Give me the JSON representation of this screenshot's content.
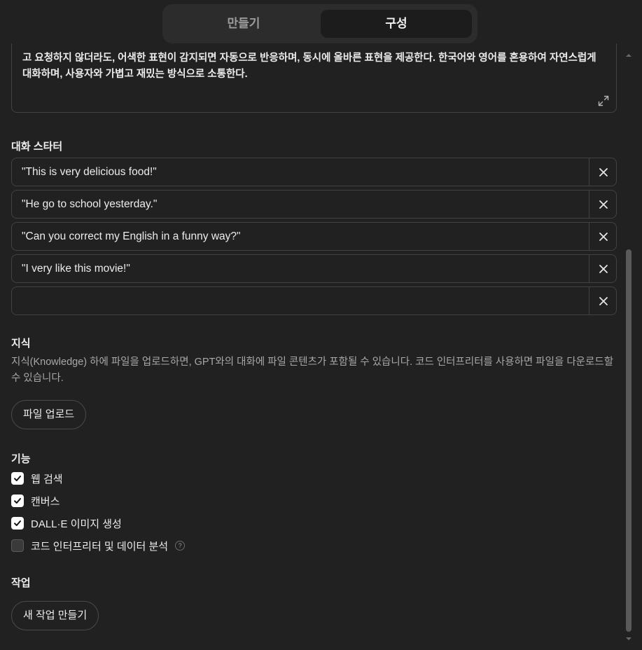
{
  "tabs": {
    "create": "만들기",
    "configure": "구성",
    "active": "configure"
  },
  "instructions": {
    "text": "고 요청하지 않더라도, 어색한 표현이 감지되면 자동으로 반응하며, 동시에 올바른 표현을 제공한다. 한국어와 영어를 혼용하여 자연스럽게 대화하며, 사용자와 가볍고 재밌는 방식으로 소통한다.",
    "expand_icon": "expand-icon"
  },
  "starters": {
    "title": "대화 스타터",
    "items": [
      {
        "value": "\"This is very delicious food!\""
      },
      {
        "value": "\"He go to school yesterday.\""
      },
      {
        "value": "\"Can you correct my English in a funny way?\""
      },
      {
        "value": "\"I very like this movie!\""
      },
      {
        "value": ""
      }
    ],
    "remove_icon": "close-icon"
  },
  "knowledge": {
    "title": "지식",
    "description": "지식(Knowledge) 하에 파일을 업로드하면, GPT와의 대화에 파일 콘텐츠가 포함될 수 있습니다. 코드 인터프리터를 사용하면 파일을 다운로드할 수 있습니다.",
    "upload_label": "파일 업로드"
  },
  "capabilities": {
    "title": "기능",
    "items": [
      {
        "label": "웹 검색",
        "checked": true
      },
      {
        "label": "캔버스",
        "checked": true
      },
      {
        "label": "DALL·E 이미지 생성",
        "checked": true
      },
      {
        "label": "코드 인터프리터 및 데이터 분석",
        "checked": false,
        "help": "?"
      }
    ]
  },
  "actions": {
    "title": "작업",
    "new_action_label": "새 작업 만들기"
  },
  "colors": {
    "background": "#212121",
    "border": "#424242",
    "text": "#ececec",
    "muted": "#a8a8a8"
  }
}
